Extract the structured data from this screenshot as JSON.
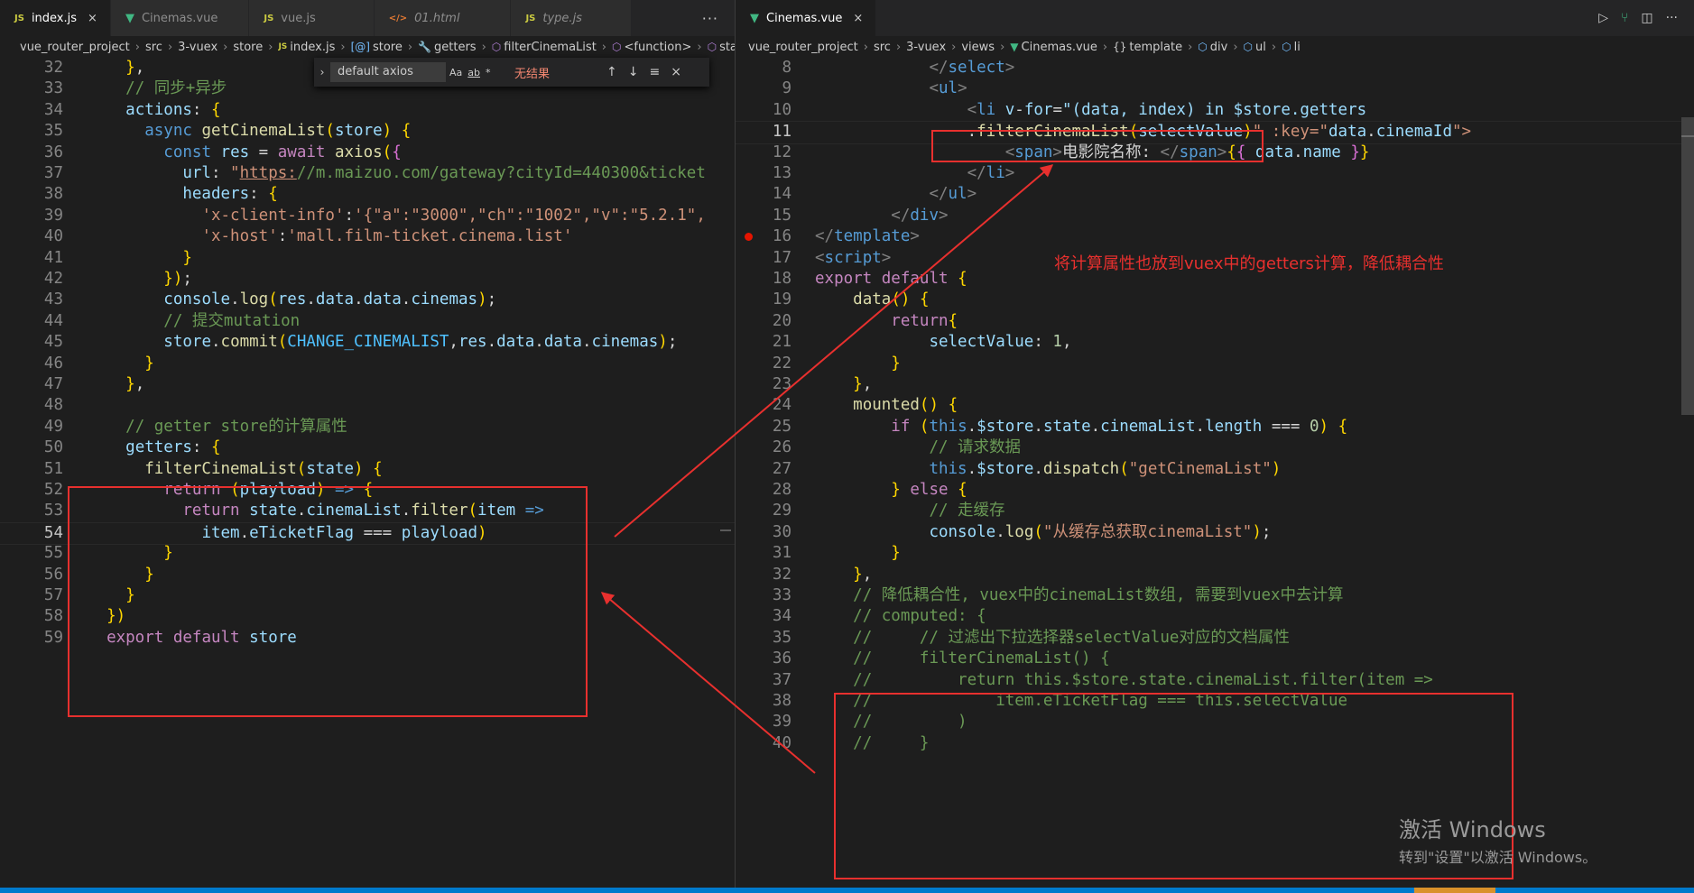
{
  "left_editor": {
    "tabs": [
      {
        "label": "index.js",
        "icon": "js-icon",
        "active": true,
        "close": "×"
      },
      {
        "label": "Cinemas.vue",
        "icon": "vue-icon",
        "active": false
      },
      {
        "label": "vue.js",
        "icon": "js-icon",
        "active": false
      },
      {
        "label": "01.html",
        "icon": "html-icon",
        "active": false
      },
      {
        "label": "type.js",
        "icon": "js-icon",
        "active": false
      }
    ],
    "more_label": "···",
    "breadcrumb": [
      "vue_router_project",
      "src",
      "3-vuex",
      "store",
      "index.js",
      "store",
      "getters",
      "filterCinemaList",
      "<function>",
      "state.ci"
    ],
    "find_widget": {
      "query": "default axios",
      "options": [
        "Aa",
        "ab",
        "*"
      ],
      "status": "无结果"
    },
    "lines": [
      {
        "n": "32",
        "code": "    },"
      },
      {
        "n": "33",
        "code": "    // 同步+异步"
      },
      {
        "n": "34",
        "code": "    actions: {"
      },
      {
        "n": "35",
        "code": "      async getCinemaList(store) {"
      },
      {
        "n": "36",
        "code": "        const res = await axios({"
      },
      {
        "n": "37",
        "code": "          url: \"https://m.maizuo.com/gateway?cityId=440300&ticket"
      },
      {
        "n": "38",
        "code": "          headers: {"
      },
      {
        "n": "39",
        "code": "            'x-client-info':'{\"a\":\"3000\",\"ch\":\"1002\",\"v\":\"5.2.1\","
      },
      {
        "n": "40",
        "code": "            'x-host':'mall.film-ticket.cinema.list'"
      },
      {
        "n": "41",
        "code": "          }"
      },
      {
        "n": "42",
        "code": "        });"
      },
      {
        "n": "43",
        "code": "        console.log(res.data.data.cinemas);"
      },
      {
        "n": "44",
        "code": "        // 提交mutation"
      },
      {
        "n": "45",
        "code": "        store.commit(CHANGE_CINEMALIST,res.data.data.cinemas);"
      },
      {
        "n": "46",
        "code": "      }"
      },
      {
        "n": "47",
        "code": "    },"
      },
      {
        "n": "48",
        "code": ""
      },
      {
        "n": "49",
        "code": "    // getter store的计算属性"
      },
      {
        "n": "50",
        "code": "    getters: {"
      },
      {
        "n": "51",
        "code": "      filterCinemaList(state) {"
      },
      {
        "n": "52",
        "code": "        return (playload) => {"
      },
      {
        "n": "53",
        "code": "          return state.cinemaList.filter(item =>"
      },
      {
        "n": "54",
        "code": "            item.eTicketFlag === playload)"
      },
      {
        "n": "55",
        "code": "        }"
      },
      {
        "n": "56",
        "code": "      }"
      },
      {
        "n": "57",
        "code": "    }"
      },
      {
        "n": "58",
        "code": "  })"
      },
      {
        "n": "59",
        "code": "  export default store"
      }
    ]
  },
  "right_editor": {
    "tabs": [
      {
        "label": "Cinemas.vue",
        "icon": "vue-icon",
        "active": true,
        "close": "×"
      }
    ],
    "breadcrumb": [
      "vue_router_project",
      "src",
      "3-vuex",
      "views",
      "Cinemas.vue",
      "template",
      "div",
      "ul",
      "li"
    ],
    "lines": [
      {
        "n": "8",
        "code": "            </select>"
      },
      {
        "n": "9",
        "code": "            <ul>"
      },
      {
        "n": "10",
        "code": "                <li v-for=\"(data, index) in $store.getters"
      },
      {
        "n": "11",
        "code": "                .filterCinemaList(selectValue)\" :key=\"data.cinemaId\">"
      },
      {
        "n": "12",
        "code": "                    <span>电影院名称: </span>{{ data.name }}"
      },
      {
        "n": "13",
        "code": "                </li>"
      },
      {
        "n": "14",
        "code": "            </ul>"
      },
      {
        "n": "15",
        "code": "        </div>"
      },
      {
        "n": "16",
        "code": "</template>"
      },
      {
        "n": "17",
        "code": "<script>"
      },
      {
        "n": "18",
        "code": "export default {"
      },
      {
        "n": "19",
        "code": "    data() {"
      },
      {
        "n": "20",
        "code": "        return{"
      },
      {
        "n": "21",
        "code": "            selectValue: 1,"
      },
      {
        "n": "22",
        "code": "        }"
      },
      {
        "n": "23",
        "code": "    },"
      },
      {
        "n": "24",
        "code": "    mounted() {"
      },
      {
        "n": "25",
        "code": "        if (this.$store.state.cinemaList.length === 0) {"
      },
      {
        "n": "26",
        "code": "            // 请求数据"
      },
      {
        "n": "27",
        "code": "            this.$store.dispatch(\"getCinemaList\")"
      },
      {
        "n": "28",
        "code": "        } else {"
      },
      {
        "n": "29",
        "code": "            // 走缓存"
      },
      {
        "n": "30",
        "code": "            console.log(\"从缓存总获取cinemaList\");"
      },
      {
        "n": "31",
        "code": "        }"
      },
      {
        "n": "32",
        "code": "    },"
      },
      {
        "n": "33",
        "code": "    // 降低耦合性, vuex中的cinemaList数组, 需要到vuex中去计算"
      },
      {
        "n": "34",
        "code": "    // computed: {"
      },
      {
        "n": "35",
        "code": "    //     // 过滤出下拉选择器selectValue对应的文档属性"
      },
      {
        "n": "36",
        "code": "    //     filterCinemaList() {"
      },
      {
        "n": "37",
        "code": "    //         return this.$store.state.cinemaList.filter(item =>"
      },
      {
        "n": "38",
        "code": "    //             item.eTicketFlag === this.selectValue"
      },
      {
        "n": "39",
        "code": "    //         )"
      },
      {
        "n": "40",
        "code": "    //     }"
      }
    ]
  },
  "annotation": {
    "text": "将计算属性也放到vuex中的getters计算，降低耦合性",
    "color": "#e8302e"
  },
  "watermark": {
    "line1": "激活 Windows",
    "line2": "转到\"设置\"以激活 Windows。"
  },
  "colors": {
    "editor_bg": "#1e1e1e",
    "tab_bg": "#252526",
    "annotation": "#e8302e",
    "status": "#007acc"
  }
}
